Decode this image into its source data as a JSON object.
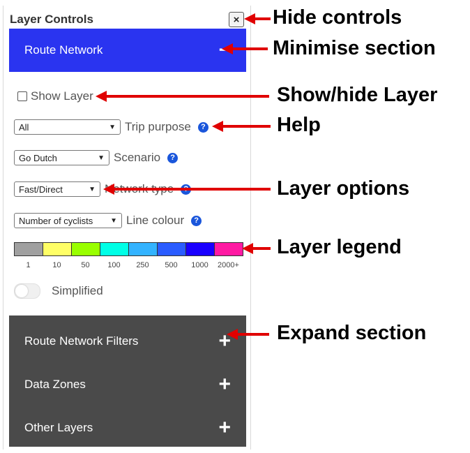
{
  "panel": {
    "title": "Layer Controls",
    "close_glyph": "×",
    "route_network": {
      "label": "Route Network",
      "toggle": "−"
    },
    "show_layer": "Show Layer",
    "options": [
      {
        "select": "All",
        "label": "Trip purpose"
      },
      {
        "select": "Go Dutch",
        "label": "Scenario"
      },
      {
        "select": "Fast/Direct",
        "label": "Network type"
      },
      {
        "select": "Number of cyclists",
        "label": "Line colour"
      }
    ],
    "help_glyph": "?",
    "legend": {
      "colors": [
        "#a0a0a0",
        "#ffff66",
        "#99ff00",
        "#00ffe6",
        "#33b3ff",
        "#2a5cff",
        "#1a00ff",
        "#ff1aa3"
      ],
      "labels": [
        "1",
        "10",
        "50",
        "100",
        "250",
        "500",
        "1000",
        "2000+"
      ]
    },
    "simplified": "Simplified",
    "collapsed_sections": [
      {
        "label": "Route Network Filters",
        "toggle": "+"
      },
      {
        "label": "Data Zones",
        "toggle": "+"
      },
      {
        "label": "Other Layers",
        "toggle": "+"
      }
    ]
  },
  "annotations": {
    "hide_controls": "Hide controls",
    "minimise_section": "Minimise section",
    "show_hide_layer": "Show/hide Layer",
    "help": "Help",
    "layer_options": "Layer options",
    "layer_legend": "Layer legend",
    "expand_section": "Expand section"
  },
  "colors": {
    "section_blue": "#2a34f0",
    "section_grey": "#4a4a4a",
    "help_blue": "#1a56db",
    "arrow_red": "#e00000"
  }
}
